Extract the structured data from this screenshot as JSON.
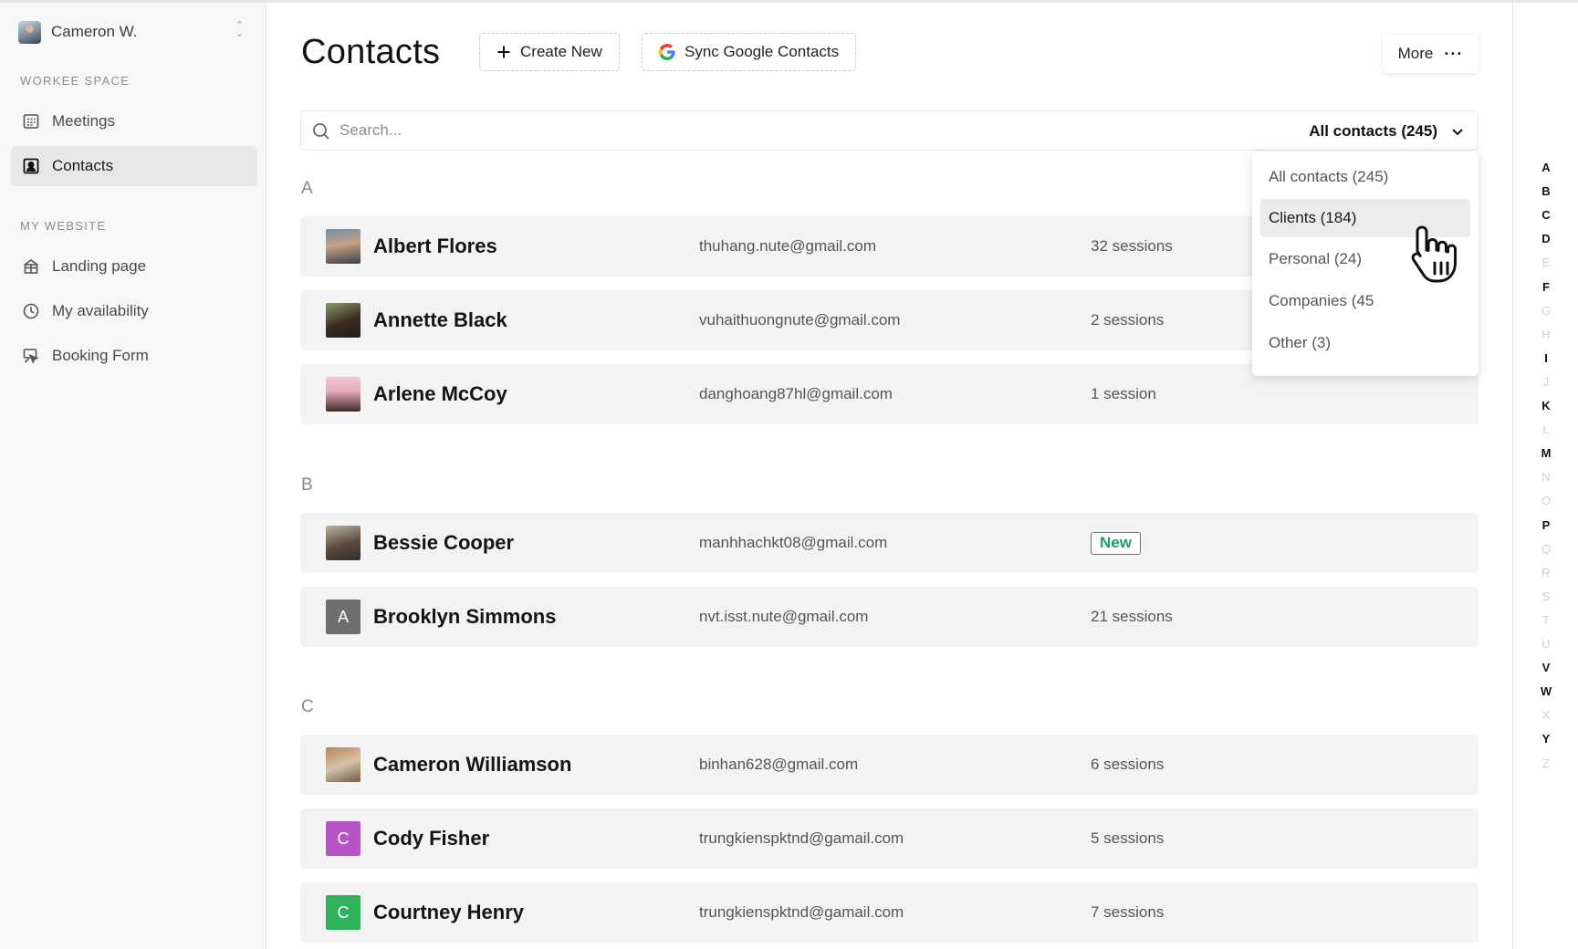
{
  "user": {
    "name": "Cameron W."
  },
  "sidebar": {
    "sections": [
      {
        "label": "WORKEE SPACE",
        "items": [
          {
            "label": "Meetings",
            "icon": "calendar-icon",
            "active": false
          },
          {
            "label": "Contacts",
            "icon": "contact-card-icon",
            "active": true
          }
        ]
      },
      {
        "label": "MY WEBSITE",
        "items": [
          {
            "label": "Landing page",
            "icon": "storefront-icon",
            "active": false
          },
          {
            "label": "My availability",
            "icon": "clock-icon",
            "active": false
          },
          {
            "label": "Booking Form",
            "icon": "form-cursor-icon",
            "active": false
          }
        ]
      }
    ]
  },
  "header": {
    "title": "Contacts",
    "create_label": "Create New",
    "sync_label": "Sync Google Contacts",
    "more_label": "More"
  },
  "search": {
    "placeholder": "Search...",
    "value": ""
  },
  "filter": {
    "selected": "All contacts (245)",
    "options": [
      "All contacts (245)",
      "Clients (184)",
      "Personal (24)",
      "Companies (45",
      "Other (3)"
    ],
    "hovered_index": 1
  },
  "groups": [
    {
      "letter": "A",
      "contacts": [
        {
          "name": "Albert Flores",
          "email": "thuhang.nute@gmail.com",
          "sessions": "32 sessions"
        },
        {
          "name": "Annette Black",
          "email": "vuhaithuongnute@gmail.com",
          "sessions": "2 sessions"
        },
        {
          "name": "Arlene McCoy",
          "email": "danghoang87hl@gmail.com",
          "sessions": "1 session"
        }
      ]
    },
    {
      "letter": "B",
      "contacts": [
        {
          "name": "Bessie Cooper",
          "email": "manhhachkt08@gmail.com",
          "badge": "New"
        },
        {
          "name": "Brooklyn Simmons",
          "email": "nvt.isst.nute@gmail.com",
          "sessions": "21 sessions",
          "initial": "A"
        }
      ]
    },
    {
      "letter": "C",
      "contacts": [
        {
          "name": "Cameron Williamson",
          "email": "binhan628@gmail.com",
          "sessions": "6 sessions"
        },
        {
          "name": "Cody Fisher",
          "email": "trungkienspktnd@gamail.com",
          "sessions": "5 sessions",
          "initial": "C"
        },
        {
          "name": "Courtney Henry",
          "email": "trungkienspktnd@gamail.com",
          "sessions": "7 sessions",
          "initial": "C"
        }
      ]
    }
  ],
  "alphabet": [
    {
      "l": "A",
      "on": true
    },
    {
      "l": "B",
      "on": true
    },
    {
      "l": "C",
      "on": true
    },
    {
      "l": "D",
      "on": true
    },
    {
      "l": "E",
      "on": false
    },
    {
      "l": "F",
      "on": true
    },
    {
      "l": "G",
      "on": false
    },
    {
      "l": "H",
      "on": false
    },
    {
      "l": "I",
      "on": true
    },
    {
      "l": "J",
      "on": false
    },
    {
      "l": "K",
      "on": true
    },
    {
      "l": "L",
      "on": false
    },
    {
      "l": "M",
      "on": true
    },
    {
      "l": "N",
      "on": false
    },
    {
      "l": "O",
      "on": false
    },
    {
      "l": "P",
      "on": true
    },
    {
      "l": "Q",
      "on": false
    },
    {
      "l": "R",
      "on": false
    },
    {
      "l": "S",
      "on": false
    },
    {
      "l": "T",
      "on": false
    },
    {
      "l": "U",
      "on": false
    },
    {
      "l": "V",
      "on": true
    },
    {
      "l": "W",
      "on": true
    },
    {
      "l": "X",
      "on": false
    },
    {
      "l": "Y",
      "on": true
    },
    {
      "l": "Z",
      "on": false
    }
  ],
  "colors": {
    "new_badge": "#19a063",
    "avatar_purple": "#b754c6",
    "avatar_green": "#2fb45c",
    "avatar_gray": "#6c6e70"
  }
}
